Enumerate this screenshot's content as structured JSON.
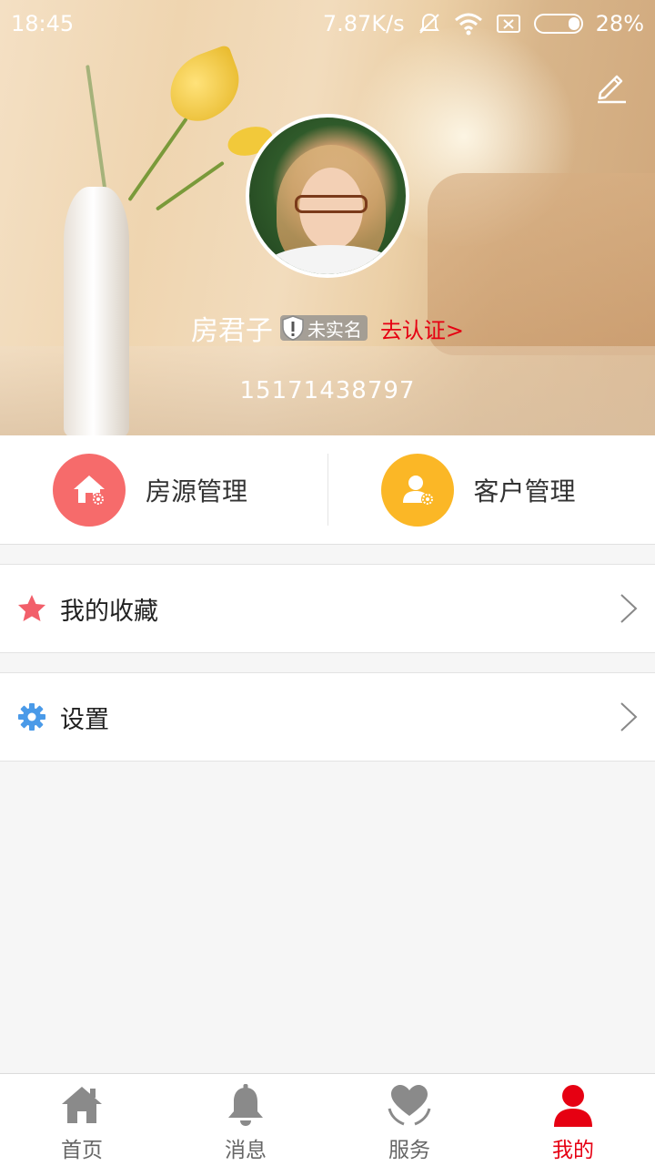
{
  "status_bar": {
    "time": "18:45",
    "network_speed": "7.87K/s",
    "battery": "28%"
  },
  "profile": {
    "name": "房君子",
    "verify_status": "未实名",
    "verify_link": "去认证>",
    "phone": "15171438797"
  },
  "quick_actions": [
    {
      "label": "房源管理",
      "icon": "house-gear-icon",
      "color": "#f66b6b"
    },
    {
      "label": "客户管理",
      "icon": "person-gear-icon",
      "color": "#fbb726"
    }
  ],
  "menu": [
    {
      "label": "我的收藏",
      "icon": "star-icon",
      "color": "#f25f6a"
    },
    {
      "label": "设置",
      "icon": "gear-icon",
      "color": "#4a9ae8"
    }
  ],
  "tabs": [
    {
      "label": "首页",
      "icon": "home-icon",
      "active": false
    },
    {
      "label": "消息",
      "icon": "bell-icon",
      "active": false
    },
    {
      "label": "服务",
      "icon": "heart-hands-icon",
      "active": false
    },
    {
      "label": "我的",
      "icon": "person-icon",
      "active": true
    }
  ],
  "colors": {
    "accent": "#e60012",
    "inactive_icon": "#8a8a8a"
  }
}
